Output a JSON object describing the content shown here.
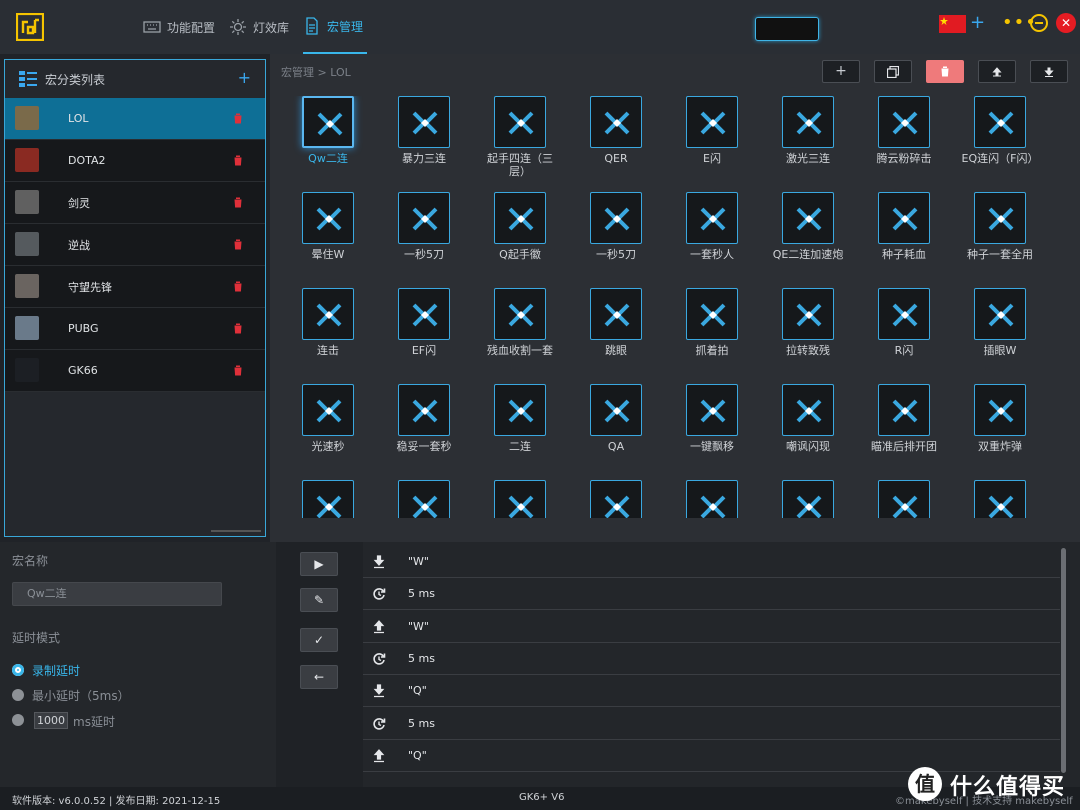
{
  "header": {
    "tabs": [
      {
        "label": "功能配置"
      },
      {
        "label": "灯效库"
      },
      {
        "label": "宏管理"
      }
    ],
    "colors": {
      "accent": "#39b6ea",
      "danger": "#e0303a",
      "warn": "#f5c400"
    }
  },
  "sidebar": {
    "title": "宏分类列表",
    "add": "+",
    "items": [
      {
        "label": "LOL"
      },
      {
        "label": "DOTA2"
      },
      {
        "label": "剑灵"
      },
      {
        "label": "逆战"
      },
      {
        "label": "守望先锋"
      },
      {
        "label": "PUBG"
      },
      {
        "label": "GK66"
      }
    ]
  },
  "main": {
    "breadcrumb": "宏管理  >  LOL",
    "toolbar": {
      "add": "+",
      "copy": "⧉",
      "delete": "🗑",
      "export": "⤒",
      "import": "⤓"
    },
    "macros": [
      {
        "label": "Qw二连"
      },
      {
        "label": "暴力三连"
      },
      {
        "label": "起手四连（三层）"
      },
      {
        "label": "QER"
      },
      {
        "label": "E闪"
      },
      {
        "label": "激光三连"
      },
      {
        "label": "腾云粉碎击"
      },
      {
        "label": "EQ连闪（F闪）"
      },
      {
        "label": "晕住W"
      },
      {
        "label": "一秒5刀"
      },
      {
        "label": "Q起手徽"
      },
      {
        "label": "一秒5刀"
      },
      {
        "label": "一套秒人"
      },
      {
        "label": "QE二连加速炮"
      },
      {
        "label": "种子耗血"
      },
      {
        "label": "种子一套全用"
      },
      {
        "label": "连击"
      },
      {
        "label": "EF闪"
      },
      {
        "label": "残血收割一套"
      },
      {
        "label": "跳眼"
      },
      {
        "label": "抓着拍"
      },
      {
        "label": "拉转致残"
      },
      {
        "label": "R闪"
      },
      {
        "label": "插眼W"
      },
      {
        "label": "光速秒"
      },
      {
        "label": "稳妥一套秒"
      },
      {
        "label": "二连"
      },
      {
        "label": "QA"
      },
      {
        "label": "一键飘移"
      },
      {
        "label": "嘲讽闪现"
      },
      {
        "label": "瞄准后排开团"
      },
      {
        "label": "双重炸弹"
      },
      {
        "label": ""
      },
      {
        "label": ""
      },
      {
        "label": ""
      },
      {
        "label": ""
      },
      {
        "label": ""
      },
      {
        "label": ""
      },
      {
        "label": ""
      },
      {
        "label": ""
      }
    ]
  },
  "editor": {
    "name_label": "宏名称",
    "name_value": "Qw二连",
    "delay_label": "延时模式",
    "modes": [
      {
        "label": "录制延时"
      },
      {
        "label": "最小延时（5ms）"
      },
      {
        "label": "ms延时"
      }
    ],
    "custom_delay": "1000",
    "buttons": {
      "play": "▶",
      "edit": "✎",
      "confirm": "✓",
      "back": "←"
    },
    "steps": [
      {
        "type": "down",
        "value": "\"W\""
      },
      {
        "type": "delay",
        "value": "5 ms"
      },
      {
        "type": "up",
        "value": "\"W\""
      },
      {
        "type": "delay",
        "value": "5 ms"
      },
      {
        "type": "down",
        "value": "\"Q\""
      },
      {
        "type": "delay",
        "value": "5 ms"
      },
      {
        "type": "up",
        "value": "\"Q\""
      }
    ]
  },
  "status": {
    "version": "软件版本: v6.0.0.52 | 发布日期: 2021-12-15",
    "model": "GK6+ V6",
    "credit": "©makebyself | 技术支持 makebyself"
  },
  "watermark": {
    "text": "什么值得买",
    "mark": "值"
  }
}
